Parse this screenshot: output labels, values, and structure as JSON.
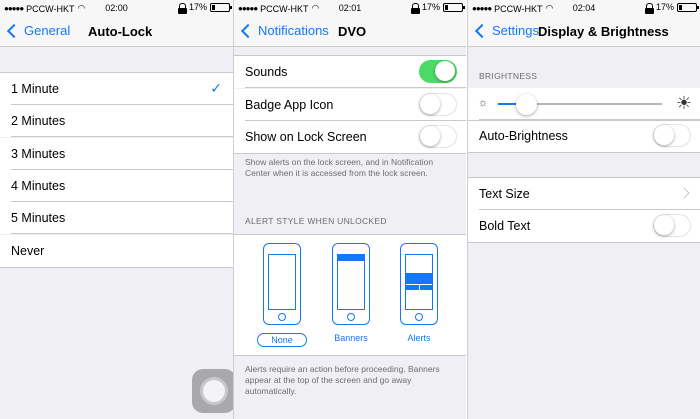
{
  "panels": {
    "auto_lock": {
      "status": {
        "carrier": "PCCW-HKT",
        "time": "02:00",
        "battery": "17%"
      },
      "nav": {
        "back": "General",
        "title": "Auto-Lock"
      },
      "options": [
        "1 Minute",
        "2 Minutes",
        "3 Minutes",
        "4 Minutes",
        "5 Minutes",
        "Never"
      ],
      "selected": "1 Minute",
      "check_icon": "checkmark-icon"
    },
    "notifications": {
      "status": {
        "carrier": "PCCW-HKT",
        "time": "02:01",
        "battery": "17%"
      },
      "nav": {
        "back": "Notifications",
        "title": "DVO"
      },
      "rows": [
        {
          "label": "Sounds",
          "on": true
        },
        {
          "label": "Badge App Icon",
          "on": false
        },
        {
          "label": "Show on Lock Screen",
          "on": false
        }
      ],
      "lock_screen_note": "Show alerts on the lock screen, and in Notification Center when it is accessed from the lock screen.",
      "alert_style_header": "ALERT STYLE WHEN UNLOCKED",
      "alert_styles": [
        "None",
        "Banners",
        "Alerts"
      ],
      "alert_style_selected": "None",
      "alert_style_note": "Alerts require an action before proceeding. Banners appear at the top of the screen and go away automatically."
    },
    "display": {
      "status": {
        "carrier": "PCCW-HKT",
        "time": "02:04",
        "battery": "17%"
      },
      "nav": {
        "back": "Settings",
        "title": "Display & Brightness"
      },
      "brightness_header": "BRIGHTNESS",
      "brightness_level": 0.17,
      "auto_brightness": {
        "label": "Auto-Brightness",
        "on": false
      },
      "text_size": {
        "label": "Text Size"
      },
      "bold_text": {
        "label": "Bold Text",
        "on": false
      }
    }
  },
  "colors": {
    "accent": "#1478f5",
    "toggle_on": "#4cd964",
    "background": "#efeff4"
  }
}
